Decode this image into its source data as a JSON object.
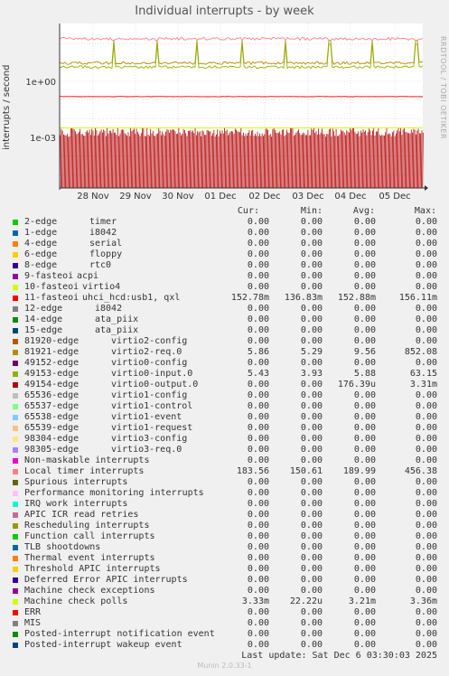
{
  "page": {
    "title": "Individual interrupts - by week",
    "watermark": "RRDTOOL / TOBI OETIKER",
    "ylabel": "interrupts / second",
    "last_update": "Last update:  Sat Dec  6 03:30:03 2025",
    "munin": "Munin 2.0.33-1"
  },
  "chart_data": {
    "type": "line",
    "title": "Individual interrupts - by week",
    "ylabel": "interrupts / second",
    "yscale": "log",
    "yticks": [
      "1e+00",
      "1e-03"
    ],
    "xticks": [
      "28 Nov",
      "29 Nov",
      "30 Nov",
      "01 Dec",
      "02 Dec",
      "03 Dec",
      "04 Dec",
      "05 Dec"
    ],
    "grid": true,
    "headers": [
      "Cur:",
      "Min:",
      "Avg:",
      "Max:"
    ],
    "series": [
      {
        "name": "2-edge",
        "desc": "timer",
        "color": "#00cc00",
        "cur": "0.00",
        "min": "0.00",
        "avg": "0.00",
        "max": "0.00"
      },
      {
        "name": "1-edge",
        "desc": "i8042",
        "color": "#0066b3",
        "cur": "0.00",
        "min": "0.00",
        "avg": "0.00",
        "max": "0.00"
      },
      {
        "name": "4-edge",
        "desc": "serial",
        "color": "#ff8000",
        "cur": "0.00",
        "min": "0.00",
        "avg": "0.00",
        "max": "0.00"
      },
      {
        "name": "6-edge",
        "desc": "floppy",
        "color": "#ffcc00",
        "cur": "0.00",
        "min": "0.00",
        "avg": "0.00",
        "max": "0.00"
      },
      {
        "name": "8-edge",
        "desc": "rtc0",
        "color": "#330099",
        "cur": "0.00",
        "min": "0.00",
        "avg": "0.00",
        "max": "0.00"
      },
      {
        "name": "9-fasteoi",
        "desc": "acpi",
        "color": "#990099",
        "cur": "0.00",
        "min": "0.00",
        "avg": "0.00",
        "max": "0.00"
      },
      {
        "name": "10-fasteoi",
        "desc": "virtio4",
        "color": "#ccff00",
        "cur": "0.00",
        "min": "0.00",
        "avg": "0.00",
        "max": "0.00"
      },
      {
        "name": "11-fasteoi",
        "desc": "uhci_hcd:usb1, qxl",
        "color": "#ff0000",
        "cur": "152.78m",
        "min": "136.83m",
        "avg": "152.88m",
        "max": "156.11m"
      },
      {
        "name": "12-edge",
        "desc": "i8042",
        "color": "#808080",
        "cur": "0.00",
        "min": "0.00",
        "avg": "0.00",
        "max": "0.00"
      },
      {
        "name": "14-edge",
        "desc": "ata_piix",
        "color": "#008f00",
        "cur": "0.00",
        "min": "0.00",
        "avg": "0.00",
        "max": "0.00"
      },
      {
        "name": "15-edge",
        "desc": "ata_piix",
        "color": "#00487d",
        "cur": "0.00",
        "min": "0.00",
        "avg": "0.00",
        "max": "0.00"
      },
      {
        "name": "81920-edge",
        "desc": "virtio2-config",
        "color": "#b35a00",
        "cur": "0.00",
        "min": "0.00",
        "avg": "0.00",
        "max": "0.00"
      },
      {
        "name": "81921-edge",
        "desc": "virtio2-req.0",
        "color": "#b38f00",
        "cur": "5.86",
        "min": "5.29",
        "avg": "9.56",
        "max": "852.08"
      },
      {
        "name": "49152-edge",
        "desc": "virtio0-config",
        "color": "#6b006b",
        "cur": "0.00",
        "min": "0.00",
        "avg": "0.00",
        "max": "0.00"
      },
      {
        "name": "49153-edge",
        "desc": "virtio0-input.0",
        "color": "#8fb300",
        "cur": "5.43",
        "min": "3.93",
        "avg": "5.88",
        "max": "63.15"
      },
      {
        "name": "49154-edge",
        "desc": "virtio0-output.0",
        "color": "#b30000",
        "cur": "0.00",
        "min": "0.00",
        "avg": "176.39u",
        "max": "3.31m"
      },
      {
        "name": "65536-edge",
        "desc": "virtio1-config",
        "color": "#bebebe",
        "cur": "0.00",
        "min": "0.00",
        "avg": "0.00",
        "max": "0.00"
      },
      {
        "name": "65537-edge",
        "desc": "virtio1-control",
        "color": "#80ff80",
        "cur": "0.00",
        "min": "0.00",
        "avg": "0.00",
        "max": "0.00"
      },
      {
        "name": "65538-edge",
        "desc": "virtio1-event",
        "color": "#80c9ff",
        "cur": "0.00",
        "min": "0.00",
        "avg": "0.00",
        "max": "0.00"
      },
      {
        "name": "65539-edge",
        "desc": "virtio1-request",
        "color": "#ffc080",
        "cur": "0.00",
        "min": "0.00",
        "avg": "0.00",
        "max": "0.00"
      },
      {
        "name": "98304-edge",
        "desc": "virtio3-config",
        "color": "#ffe680",
        "cur": "0.00",
        "min": "0.00",
        "avg": "0.00",
        "max": "0.00"
      },
      {
        "name": "98305-edge",
        "desc": "virtio3-req.0",
        "color": "#aa80ff",
        "cur": "0.00",
        "min": "0.00",
        "avg": "0.00",
        "max": "0.00"
      },
      {
        "name": "Non-maskable interrupts",
        "desc": "",
        "color": "#ee00cc",
        "cur": "0.00",
        "min": "0.00",
        "avg": "0.00",
        "max": "0.00"
      },
      {
        "name": "Local timer interrupts",
        "desc": "",
        "color": "#ff8080",
        "cur": "183.56",
        "min": "150.61",
        "avg": "189.99",
        "max": "456.38"
      },
      {
        "name": "Spurious interrupts",
        "desc": "",
        "color": "#666600",
        "cur": "0.00",
        "min": "0.00",
        "avg": "0.00",
        "max": "0.00"
      },
      {
        "name": "Performance monitoring interrupts",
        "desc": "",
        "color": "#ffbfff",
        "cur": "0.00",
        "min": "0.00",
        "avg": "0.00",
        "max": "0.00"
      },
      {
        "name": "IRQ work interrupts",
        "desc": "",
        "color": "#00ffcc",
        "cur": "0.00",
        "min": "0.00",
        "avg": "0.00",
        "max": "0.00"
      },
      {
        "name": "APIC ICR read retries",
        "desc": "",
        "color": "#cc6699",
        "cur": "0.00",
        "min": "0.00",
        "avg": "0.00",
        "max": "0.00"
      },
      {
        "name": "Rescheduling interrupts",
        "desc": "",
        "color": "#999900",
        "cur": "0.00",
        "min": "0.00",
        "avg": "0.00",
        "max": "0.00"
      },
      {
        "name": "Function call interrupts",
        "desc": "",
        "color": "#00cc00",
        "cur": "0.00",
        "min": "0.00",
        "avg": "0.00",
        "max": "0.00"
      },
      {
        "name": "TLB shootdowns",
        "desc": "",
        "color": "#0066b3",
        "cur": "0.00",
        "min": "0.00",
        "avg": "0.00",
        "max": "0.00"
      },
      {
        "name": "Thermal event interrupts",
        "desc": "",
        "color": "#ff8000",
        "cur": "0.00",
        "min": "0.00",
        "avg": "0.00",
        "max": "0.00"
      },
      {
        "name": "Threshold APIC interrupts",
        "desc": "",
        "color": "#ffcc00",
        "cur": "0.00",
        "min": "0.00",
        "avg": "0.00",
        "max": "0.00"
      },
      {
        "name": "Deferred Error APIC interrupts",
        "desc": "",
        "color": "#330099",
        "cur": "0.00",
        "min": "0.00",
        "avg": "0.00",
        "max": "0.00"
      },
      {
        "name": "Machine check exceptions",
        "desc": "",
        "color": "#990099",
        "cur": "0.00",
        "min": "0.00",
        "avg": "0.00",
        "max": "0.00"
      },
      {
        "name": "Machine check polls",
        "desc": "",
        "color": "#ccff00",
        "cur": "3.33m",
        "min": "22.22u",
        "avg": "3.21m",
        "max": "3.36m"
      },
      {
        "name": "ERR",
        "desc": "",
        "color": "#ff0000",
        "cur": "0.00",
        "min": "0.00",
        "avg": "0.00",
        "max": "0.00"
      },
      {
        "name": "MIS",
        "desc": "",
        "color": "#808080",
        "cur": "0.00",
        "min": "0.00",
        "avg": "0.00",
        "max": "0.00"
      },
      {
        "name": "Posted-interrupt notification event",
        "desc": "",
        "color": "#008f00",
        "cur": "0.00",
        "min": "0.00",
        "avg": "0.00",
        "max": "0.00"
      },
      {
        "name": "Posted-interrupt wakeup event",
        "desc": "",
        "color": "#00487d",
        "cur": "0.00",
        "min": "0.00",
        "avg": "0.00",
        "max": "0.00"
      }
    ]
  }
}
